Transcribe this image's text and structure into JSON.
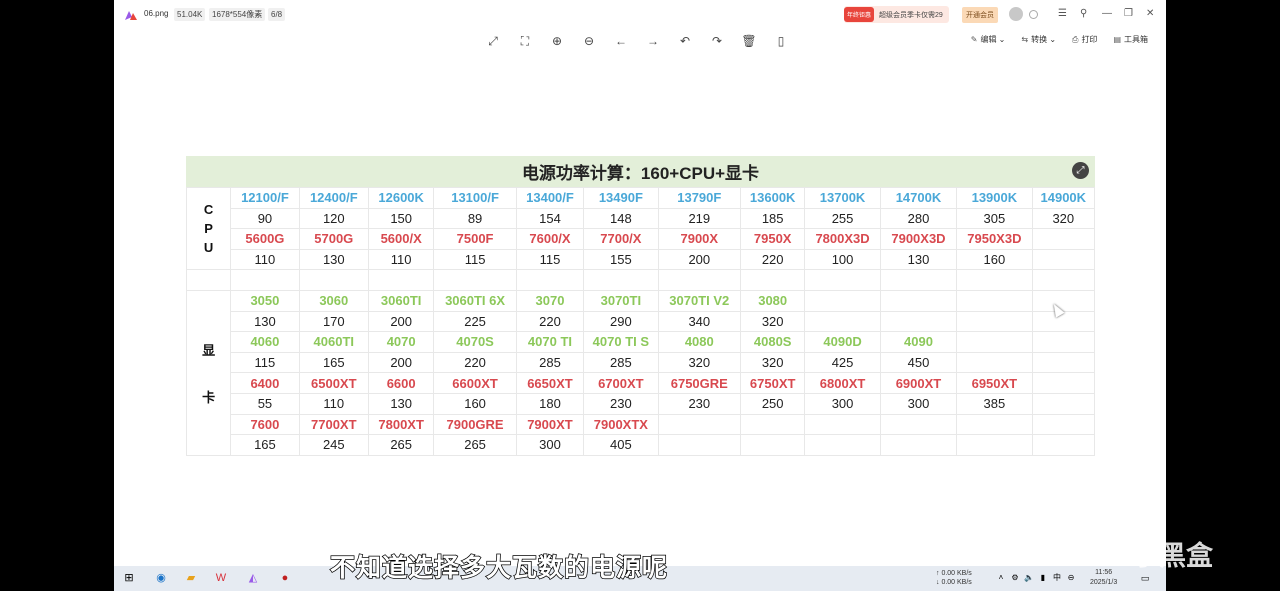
{
  "window": {
    "file_name": "06.png",
    "file_size": "51.04K",
    "dimensions": "1678*554像素",
    "page_index": "6/8",
    "promo_tag": "年终钜惠",
    "promo_text": "超级会员季卡仅需29",
    "vip_button": "开通会员"
  },
  "toolbar": {
    "icons": [
      "fit-screen-icon",
      "actual-size-icon",
      "zoom-in-icon",
      "zoom-out-icon",
      "previous-icon",
      "next-icon",
      "rotate-left-icon",
      "rotate-right-icon",
      "delete-icon",
      "more-icon"
    ],
    "edit_label": "编辑",
    "convert_label": "转换",
    "print_label": "打印",
    "toolbox_label": "工具箱"
  },
  "table": {
    "title": "电源功率计算：160+CPU+显卡",
    "cpu_label": [
      "C",
      "P",
      "U"
    ],
    "gpu_label": [
      "显",
      "卡"
    ],
    "cpu_rows": [
      {
        "type": "name",
        "color": "blue",
        "cells": [
          "12100/F",
          "12400/F",
          "12600K",
          "13100/F",
          "13400/F",
          "13490F",
          "13790F",
          "13600K",
          "13700K",
          "14700K",
          "13900K",
          "14900K"
        ]
      },
      {
        "type": "num",
        "cells": [
          "90",
          "120",
          "150",
          "89",
          "154",
          "148",
          "219",
          "185",
          "255",
          "280",
          "305",
          "320"
        ]
      },
      {
        "type": "name",
        "color": "red",
        "cells": [
          "5600G",
          "5700G",
          "5600/X",
          "7500F",
          "7600/X",
          "7700/X",
          "7900X",
          "7950X",
          "7800X3D",
          "7900X3D",
          "7950X3D",
          ""
        ]
      },
      {
        "type": "num",
        "cells": [
          "110",
          "130",
          "110",
          "115",
          "115",
          "155",
          "200",
          "220",
          "100",
          "130",
          "160",
          ""
        ]
      }
    ],
    "gpu_rows": [
      {
        "type": "name",
        "color": "green",
        "cells": [
          "3050",
          "3060",
          "3060TI",
          "3060TI 6X",
          "3070",
          "3070TI",
          "3070TI V2",
          "3080",
          "",
          "",
          "",
          ""
        ]
      },
      {
        "type": "num",
        "cells": [
          "130",
          "170",
          "200",
          "225",
          "220",
          "290",
          "340",
          "320",
          "",
          "",
          "",
          ""
        ]
      },
      {
        "type": "name",
        "color": "green",
        "cells": [
          "4060",
          "4060TI",
          "4070",
          "4070S",
          "4070 TI",
          "4070 TI S",
          "4080",
          "4080S",
          "4090D",
          "4090",
          "",
          ""
        ]
      },
      {
        "type": "num",
        "cells": [
          "115",
          "165",
          "200",
          "220",
          "285",
          "285",
          "320",
          "320",
          "425",
          "450",
          "",
          ""
        ]
      },
      {
        "type": "name",
        "color": "red",
        "cells": [
          "6400",
          "6500XT",
          "6600",
          "6600XT",
          "6650XT",
          "6700XT",
          "6750GRE",
          "6750XT",
          "6800XT",
          "6900XT",
          "6950XT",
          ""
        ]
      },
      {
        "type": "num",
        "cells": [
          "55",
          "110",
          "130",
          "160",
          "180",
          "230",
          "230",
          "250",
          "300",
          "300",
          "385",
          ""
        ]
      },
      {
        "type": "name",
        "color": "red",
        "cells": [
          "7600",
          "7700XT",
          "7800XT",
          "7900GRE",
          "7900XT",
          "7900XTX",
          "",
          "",
          "",
          "",
          "",
          ""
        ]
      },
      {
        "type": "num",
        "cells": [
          "165",
          "245",
          "265",
          "265",
          "300",
          "405",
          "",
          "",
          "",
          "",
          "",
          ""
        ]
      }
    ]
  },
  "subtitle": "不知道选择多大瓦数的电源呢",
  "taskbar": {
    "net_up": "↑ 0.00 KB/s",
    "net_down": "↓ 0.00 KB/s",
    "time": "11:56",
    "date": "2025/1/3"
  },
  "watermark": "小黑盒",
  "colors": {
    "blue": "#4aa8d8",
    "red": "#d8494f",
    "green": "#8cc85a",
    "title_bg": "#e3efd9"
  }
}
